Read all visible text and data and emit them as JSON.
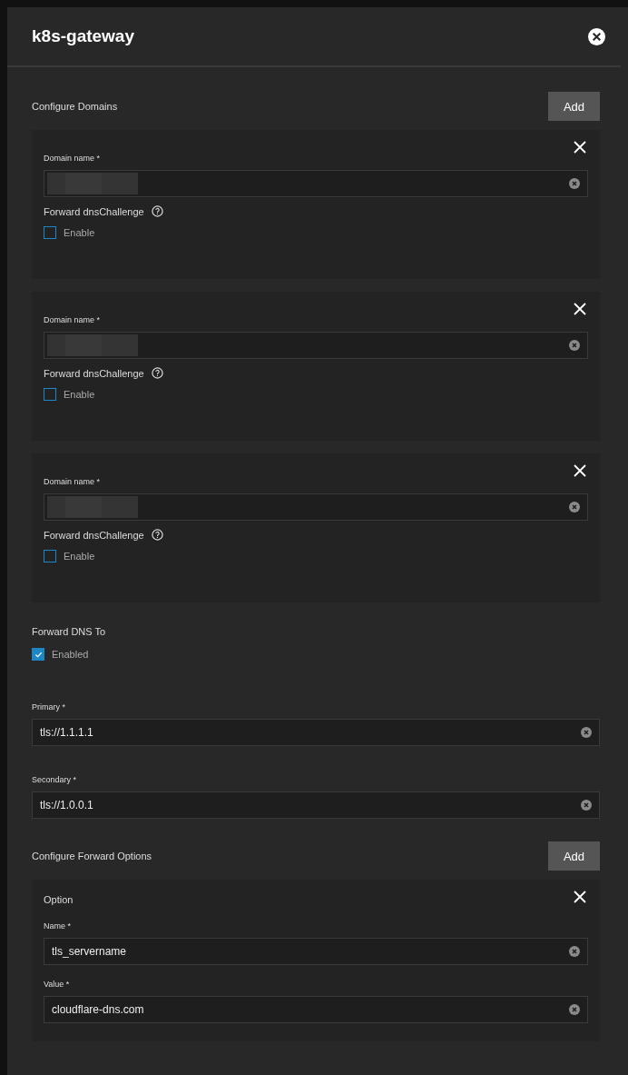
{
  "dialog": {
    "title": "k8s-gateway"
  },
  "domains": {
    "label": "Configure Domains",
    "add_button": "Add",
    "items": [
      {
        "field_label": "Domain name *",
        "challenge_label": "Forward dnsChallenge",
        "checkbox_label": "Enable",
        "checked": false
      },
      {
        "field_label": "Domain name *",
        "challenge_label": "Forward dnsChallenge",
        "checkbox_label": "Enable",
        "checked": false
      },
      {
        "field_label": "Domain name *",
        "challenge_label": "Forward dnsChallenge",
        "checkbox_label": "Enable",
        "checked": false
      }
    ]
  },
  "forward_dns": {
    "label": "Forward DNS To",
    "checkbox_label": "Enabled",
    "checked": true
  },
  "servers": [
    {
      "label": "Primary *",
      "value": "tls://1.1.1.1"
    },
    {
      "label": "Secondary *",
      "value": "tls://1.0.0.1"
    }
  ],
  "forward_options": {
    "label": "Configure Forward Options",
    "add_button": "Add",
    "items": [
      {
        "title": "Option",
        "fields": [
          {
            "label": "Name *",
            "value": "tls_servername"
          },
          {
            "label": "Value *",
            "value": "cloudflare-dns.com"
          }
        ]
      }
    ]
  }
}
